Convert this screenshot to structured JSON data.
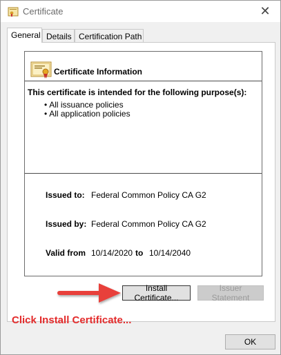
{
  "window": {
    "title": "Certificate",
    "close_glyph": "✕"
  },
  "tabs": [
    {
      "label": "General",
      "active": true
    },
    {
      "label": "Details",
      "active": false
    },
    {
      "label": "Certification Path",
      "active": false
    }
  ],
  "info": {
    "heading": "Certificate Information",
    "purpose_heading": "This certificate is intended for the following purpose(s):",
    "policies": [
      "All issuance policies",
      "All application policies"
    ],
    "issued_to_label": "Issued to:",
    "issued_to_value": "Federal Common Policy CA G2",
    "issued_by_label": "Issued by:",
    "issued_by_value": "Federal Common Policy CA G2",
    "valid_from_label": "Valid from",
    "valid_from_value": "10/14/2020",
    "valid_to_label": "to",
    "valid_to_value": "10/14/2040"
  },
  "buttons": {
    "install": "Install Certificate...",
    "issuer_statement": "Issuer Statement",
    "issuer_statement_disabled": true,
    "ok": "OK"
  },
  "annotation": {
    "text": "Click Install Certificate...",
    "color": "#e32b2b"
  },
  "icons": {
    "title": "certificate-icon",
    "info": "certificate-document-icon"
  }
}
